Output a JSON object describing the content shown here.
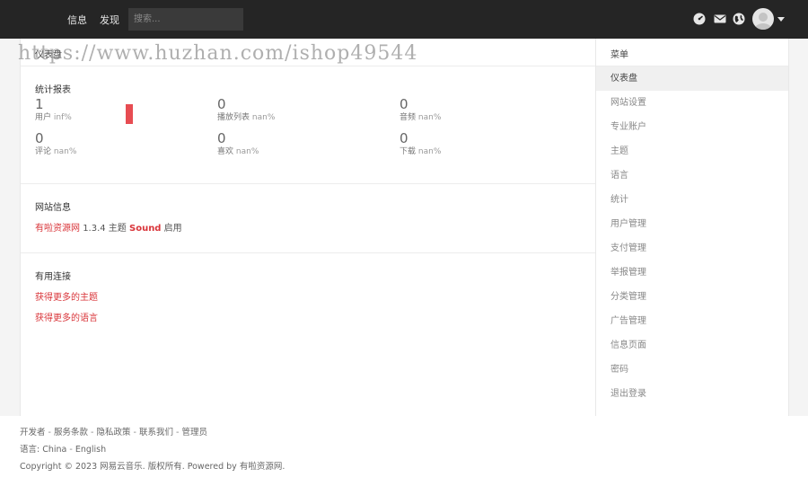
{
  "topbar": {
    "nav": [
      "信息",
      "发现"
    ],
    "search_placeholder": "搜索..."
  },
  "main": {
    "title": "仪表盘",
    "stats_title": "统计报表",
    "stats": [
      {
        "value": "1",
        "label": "用户",
        "pct": "inf%"
      },
      {
        "value": "0",
        "label": "播放列表",
        "pct": "nan%"
      },
      {
        "value": "0",
        "label": "音频",
        "pct": "nan%"
      },
      {
        "value": "0",
        "label": "评论",
        "pct": "nan%"
      },
      {
        "value": "0",
        "label": "喜欢",
        "pct": "nan%"
      },
      {
        "value": "0",
        "label": "下载",
        "pct": "nan%"
      }
    ],
    "site_info_title": "网站信息",
    "site_info": {
      "name": "有啦资源网",
      "version": "1.3.4 主题",
      "theme": "Sound",
      "status": "启用"
    },
    "links_title": "有用连接",
    "links": [
      "获得更多的主题",
      "获得更多的语言"
    ]
  },
  "sidebar": {
    "title": "菜单",
    "items": [
      "仪表盘",
      "网站设置",
      "专业账户",
      "主题",
      "语言",
      "统计",
      "用户管理",
      "支付管理",
      "举报管理",
      "分类管理",
      "广告管理",
      "信息页面",
      "密码",
      "退出登录"
    ]
  },
  "footer": {
    "links": [
      "开发者",
      "服务条款",
      "隐私政策",
      "联系我们",
      "管理员"
    ],
    "lang_label": "语言:",
    "languages": [
      "China",
      "English"
    ],
    "copyright": "Copyright © 2023 网易云音乐. 版权所有. Powered by 有啦资源网."
  },
  "watermark": "https://www.huzhan.com/ishop49544",
  "colors": {
    "accent": "#d9353a",
    "topbar": "#252525",
    "bar": "#e74c52"
  }
}
